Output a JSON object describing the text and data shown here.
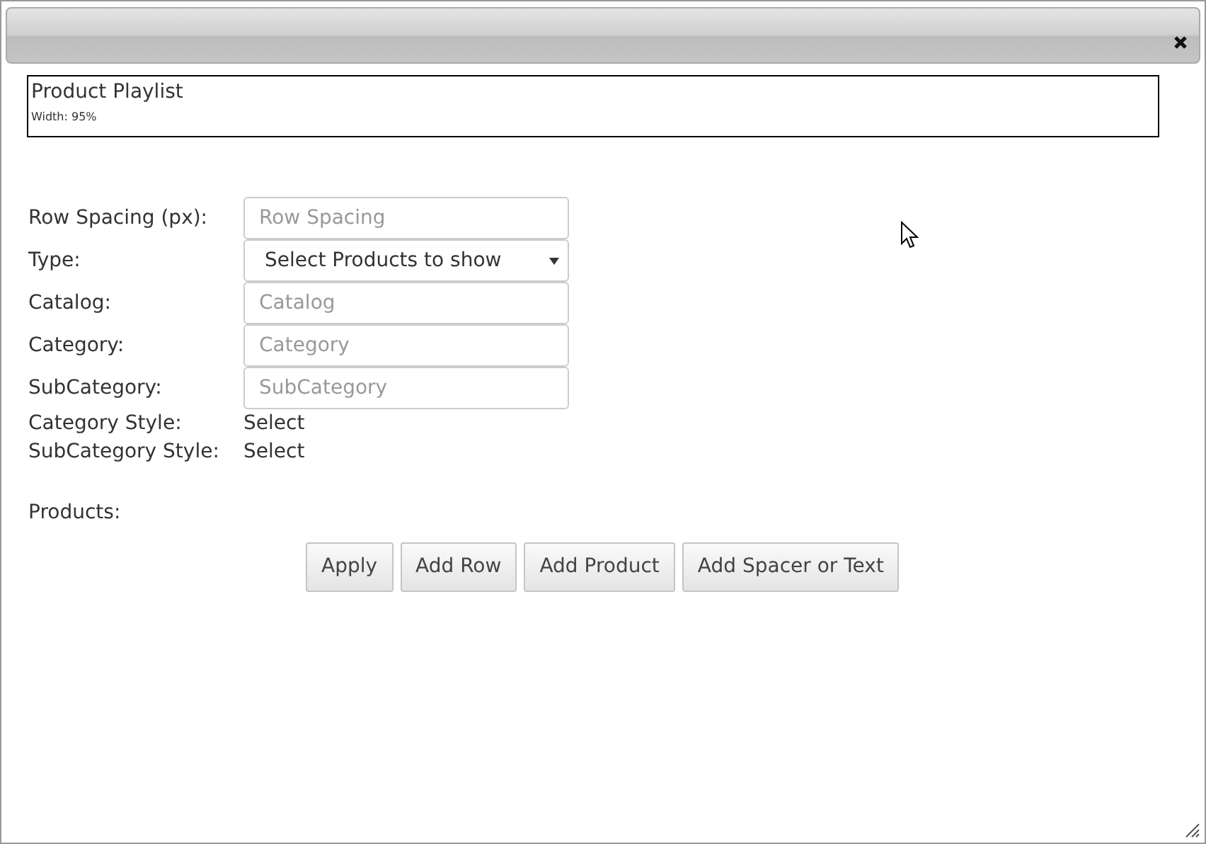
{
  "widget": {
    "title": "Product Playlist",
    "width_note": "Width: 95%"
  },
  "fields": [
    {
      "kind": "input",
      "label": "Row Spacing (px):",
      "placeholder": "Row Spacing"
    },
    {
      "kind": "select",
      "label": "Type:",
      "value": "Select Products to show"
    },
    {
      "kind": "input",
      "label": "Catalog:",
      "placeholder": "Catalog"
    },
    {
      "kind": "input",
      "label": "Category:",
      "placeholder": "Category"
    },
    {
      "kind": "input",
      "label": "SubCategory:",
      "placeholder": "SubCategory"
    },
    {
      "kind": "text",
      "label": "Category Style:",
      "value": "Select"
    },
    {
      "kind": "text",
      "label": "SubCategory Style:",
      "value": "Select"
    }
  ],
  "products_label": "Products:",
  "buttons": [
    "Apply",
    "Add Row",
    "Add Product",
    "Add Spacer or Text"
  ]
}
